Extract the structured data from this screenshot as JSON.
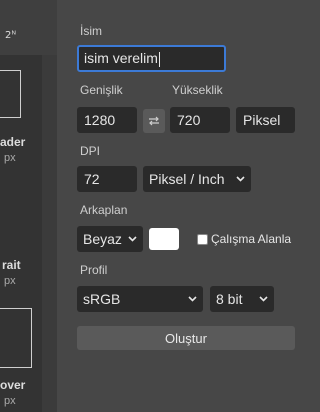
{
  "sidebar": {
    "top_label": "2ᴺ",
    "presets": [
      {
        "name": "ader",
        "unit": "px"
      },
      {
        "name": "rait",
        "unit": "px"
      },
      {
        "name": "over",
        "unit": "px"
      }
    ]
  },
  "form": {
    "name_label": "İsim",
    "name_value": "isim verelim",
    "width_label": "Genişlik",
    "width_value": "1280",
    "height_label": "Yükseklik",
    "height_value": "720",
    "size_unit": "Piksel",
    "dpi_label": "DPI",
    "dpi_value": "72",
    "dpi_unit": "Piksel / Inch",
    "background_label": "Arkaplan",
    "background_value": "Beyaz",
    "background_color": "#ffffff",
    "workspace_checkbox_label": "Çalışma Alanla",
    "profile_label": "Profil",
    "profile_value": "sRGB",
    "bit_depth_value": "8 bit",
    "create_label": "Oluştur"
  },
  "colors": {
    "panel_bg": "#474747",
    "input_bg": "#2a2a2a",
    "focus_border": "#3c7ad6",
    "button_bg": "#5a5a5a"
  }
}
